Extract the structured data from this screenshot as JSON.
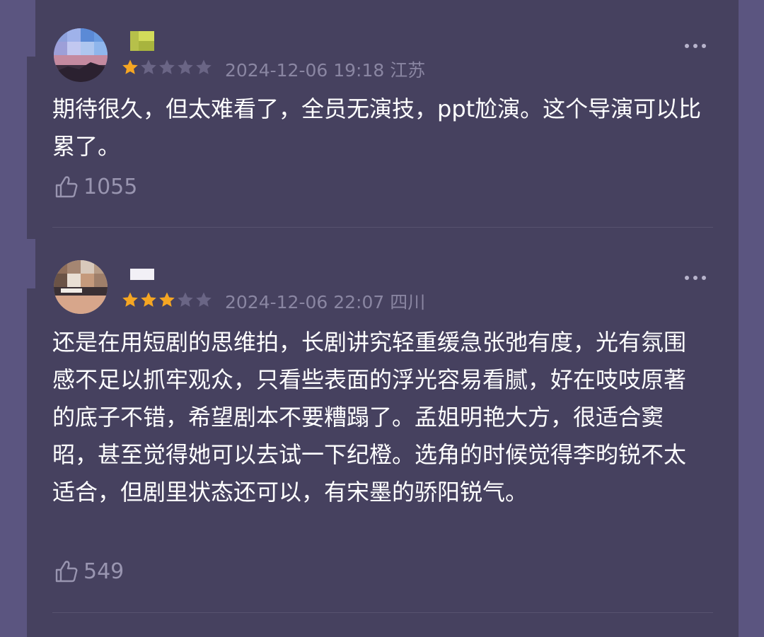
{
  "reviews": [
    {
      "rating": 1,
      "max_rating": 5,
      "date_time": "2024-12-06 19:18",
      "location": "江苏",
      "text": "期待很久，但太难看了，全员无演技，ppt尬演。这个导演可以比累了。",
      "likes": "1055"
    },
    {
      "rating": 3,
      "max_rating": 5,
      "date_time": "2024-12-06 22:07",
      "location": "四川",
      "text": "还是在用短剧的思维拍，长剧讲究轻重缓急张弛有度，光有氛围感不足以抓牢观众，只看些表面的浮光容易看腻，好在吱吱原著的底子不错，希望剧本不要糟蹋了。孟姐明艳大方，很适合窦昭，甚至觉得她可以去试一下纪橙。选角的时候觉得李昀锐不太适合，但剧里状态还可以，有宋墨的骄阳锐气。",
      "likes": "549"
    }
  ],
  "colors": {
    "star_filled": "#f5a623",
    "star_empty": "#6a6585",
    "background": "#46415f"
  },
  "icons": {
    "more": "more-dots-icon",
    "like": "thumbs-up-icon",
    "star": "star-icon"
  }
}
